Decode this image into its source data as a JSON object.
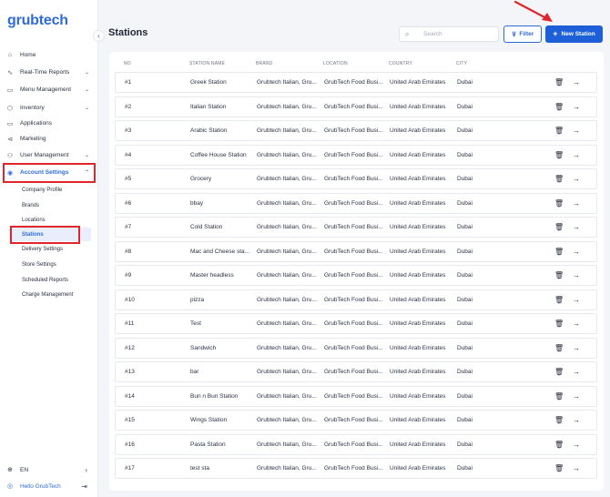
{
  "app": {
    "logo": "grubtech"
  },
  "sidebar": {
    "collapse_icon": "‹",
    "items": [
      {
        "label": "Home",
        "icon": "home-icon",
        "glyph": "⌂",
        "chev": ""
      },
      {
        "label": "Real-Time Reports",
        "icon": "pulse-icon",
        "glyph": "∿",
        "chev": "⌄"
      },
      {
        "label": "Menu Management",
        "icon": "book-icon",
        "glyph": "▭",
        "chev": "⌄"
      },
      {
        "label": "Inventory",
        "icon": "box-icon",
        "glyph": "⬡",
        "chev": "⌄"
      },
      {
        "label": "Applications",
        "icon": "monitor-icon",
        "glyph": "▭",
        "chev": ""
      },
      {
        "label": "Marketing",
        "icon": "megaphone-icon",
        "glyph": "⊲",
        "chev": ""
      },
      {
        "label": "User Management",
        "icon": "user-icon",
        "glyph": "⚇",
        "chev": "⌄"
      },
      {
        "label": "Account Settings",
        "icon": "settings-icon",
        "glyph": "◉",
        "chev": "⌃"
      }
    ],
    "sub_items": [
      "Company Profile",
      "Brands",
      "Locations",
      "Stations",
      "Delivery Settings",
      "Store Settings",
      "Scheduled Reports",
      "Charge Management"
    ],
    "language": {
      "label": "EN",
      "icon": "globe-icon",
      "glyph": "⊕",
      "arrow": "›"
    },
    "user": {
      "label": "Hello GrubTech",
      "icon": "user-circle-icon",
      "glyph": "◎",
      "arrow": "⇥"
    }
  },
  "header": {
    "title": "Stations",
    "search_placeholder": "Search",
    "filter_label": "Filter",
    "new_label": "New Station"
  },
  "table": {
    "columns": [
      "NO",
      "STATION NAME",
      "BRAND",
      "LOCATION",
      "COUNTRY",
      "CITY"
    ],
    "rows": [
      {
        "no": "#1",
        "name": "Greek Station",
        "brand": "Grubtech Italian, Gru...",
        "location": "GrubTech Food Busi...",
        "country": "United Arab Emirates",
        "city": "Dubai"
      },
      {
        "no": "#2",
        "name": "Italian Station",
        "brand": "Grubtech Italian, Gru...",
        "location": "GrubTech Food Busi...",
        "country": "United Arab Emirates",
        "city": "Dubai"
      },
      {
        "no": "#3",
        "name": "Arabic Station",
        "brand": "Grubtech Italian, Gru...",
        "location": "GrubTech Food Busi...",
        "country": "United Arab Emirates",
        "city": "Dubai"
      },
      {
        "no": "#4",
        "name": "Coffee House Station",
        "brand": "Grubtech Italian, Gru...",
        "location": "GrubTech Food Busi...",
        "country": "United Arab Emirates",
        "city": "Dubai"
      },
      {
        "no": "#5",
        "name": "Grocery",
        "brand": "Grubtech Italian, Gru...",
        "location": "GrubTech Food Busi...",
        "country": "United Arab Emirates",
        "city": "Dubai"
      },
      {
        "no": "#6",
        "name": "bbay",
        "brand": "Grubtech Italian, Gru...",
        "location": "GrubTech Food Busi...",
        "country": "United Arab Emirates",
        "city": "Dubai"
      },
      {
        "no": "#7",
        "name": "Cold Station",
        "brand": "Grubtech Italian, Gru...",
        "location": "GrubTech Food Busi...",
        "country": "United Arab Emirates",
        "city": "Dubai"
      },
      {
        "no": "#8",
        "name": "Mac and Cheese sta...",
        "brand": "Grubtech Italian, Gru...",
        "location": "GrubTech Food Busi...",
        "country": "United Arab Emirates",
        "city": "Dubai"
      },
      {
        "no": "#9",
        "name": "Master headless",
        "brand": "Grubtech Italian, Gru...",
        "location": "GrubTech Food Busi...",
        "country": "United Arab Emirates",
        "city": "Dubai"
      },
      {
        "no": "#10",
        "name": "pizza",
        "brand": "Grubtech Italian, Gru...",
        "location": "GrubTech Food Busi...",
        "country": "United Arab Emirates",
        "city": "Dubai"
      },
      {
        "no": "#11",
        "name": "Test",
        "brand": "Grubtech Italian, Gru...",
        "location": "GrubTech Food Busi...",
        "country": "United Arab Emirates",
        "city": "Dubai"
      },
      {
        "no": "#12",
        "name": "Sandwich",
        "brand": "Grubtech Italian, Gru...",
        "location": "GrubTech Food Busi...",
        "country": "United Arab Emirates",
        "city": "Dubai"
      },
      {
        "no": "#13",
        "name": "bar",
        "brand": "Grubtech Italian, Gru...",
        "location": "GrubTech Food Busi...",
        "country": "United Arab Emirates",
        "city": "Dubai"
      },
      {
        "no": "#14",
        "name": "Bun n Bun Station",
        "brand": "Grubtech Italian, Gru...",
        "location": "GrubTech Food Busi...",
        "country": "United Arab Emirates",
        "city": "Dubai"
      },
      {
        "no": "#15",
        "name": "Wings Station",
        "brand": "Grubtech Italian, Gru...",
        "location": "GrubTech Food Busi...",
        "country": "United Arab Emirates",
        "city": "Dubai"
      },
      {
        "no": "#16",
        "name": "Pasta Station",
        "brand": "Grubtech Italian, Gru...",
        "location": "GrubTech Food Busi...",
        "country": "United Arab Emirates",
        "city": "Dubai"
      },
      {
        "no": "#17",
        "name": "test sta",
        "brand": "Grubtech Italian, Gru...",
        "location": "GrubTech Food Busi...",
        "country": "United Arab Emirates",
        "city": "Dubai"
      }
    ],
    "delete_icon": "trash-icon",
    "open_icon": "arrow-right-icon"
  },
  "colors": {
    "accent": "#2f6bd8",
    "primary_button": "#1c5fd8",
    "annotation": "#e0262b",
    "background": "#f3f5f9"
  }
}
